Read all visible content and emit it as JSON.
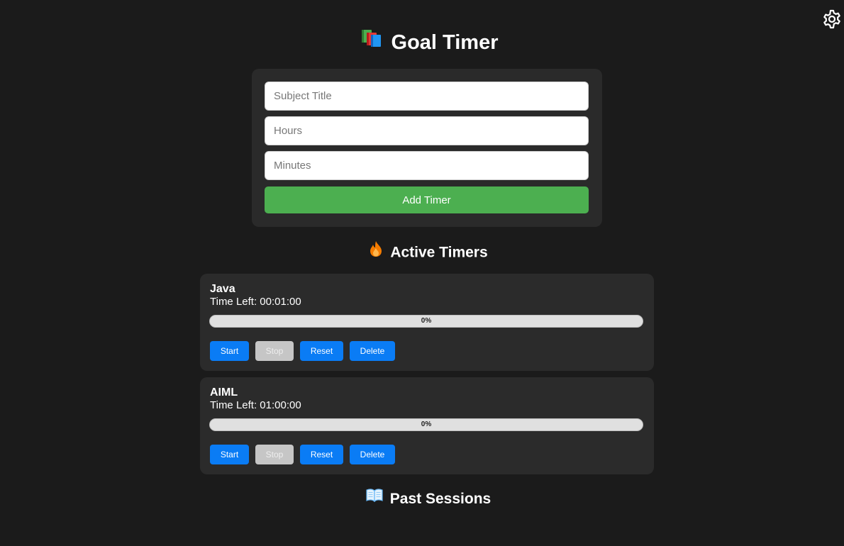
{
  "app": {
    "title": "Goal Timer",
    "title_icon": "books-icon",
    "settings_icon": "gear-icon"
  },
  "form": {
    "subject_placeholder": "Subject Title",
    "subject_value": "",
    "hours_placeholder": "Hours",
    "hours_value": "",
    "minutes_placeholder": "Minutes",
    "minutes_value": "",
    "add_label": "Add Timer"
  },
  "active": {
    "heading": "Active Timers",
    "icon": "fire-icon",
    "timers": [
      {
        "name": "Java",
        "time_left": "Time Left: 00:01:00",
        "progress_percent": 0,
        "progress_label": "0%",
        "start_label": "Start",
        "stop_label": "Stop",
        "reset_label": "Reset",
        "delete_label": "Delete"
      },
      {
        "name": "AIML",
        "time_left": "Time Left: 01:00:00",
        "progress_percent": 0,
        "progress_label": "0%",
        "start_label": "Start",
        "stop_label": "Stop",
        "reset_label": "Reset",
        "delete_label": "Delete"
      }
    ]
  },
  "past": {
    "heading": "Past Sessions",
    "icon": "open-book-icon"
  },
  "colors": {
    "background": "#1b1b1b",
    "card": "#2a2a2a",
    "add_button": "#4caf50",
    "action_button": "#0a7cf5",
    "disabled_button": "#c6c6c6"
  }
}
